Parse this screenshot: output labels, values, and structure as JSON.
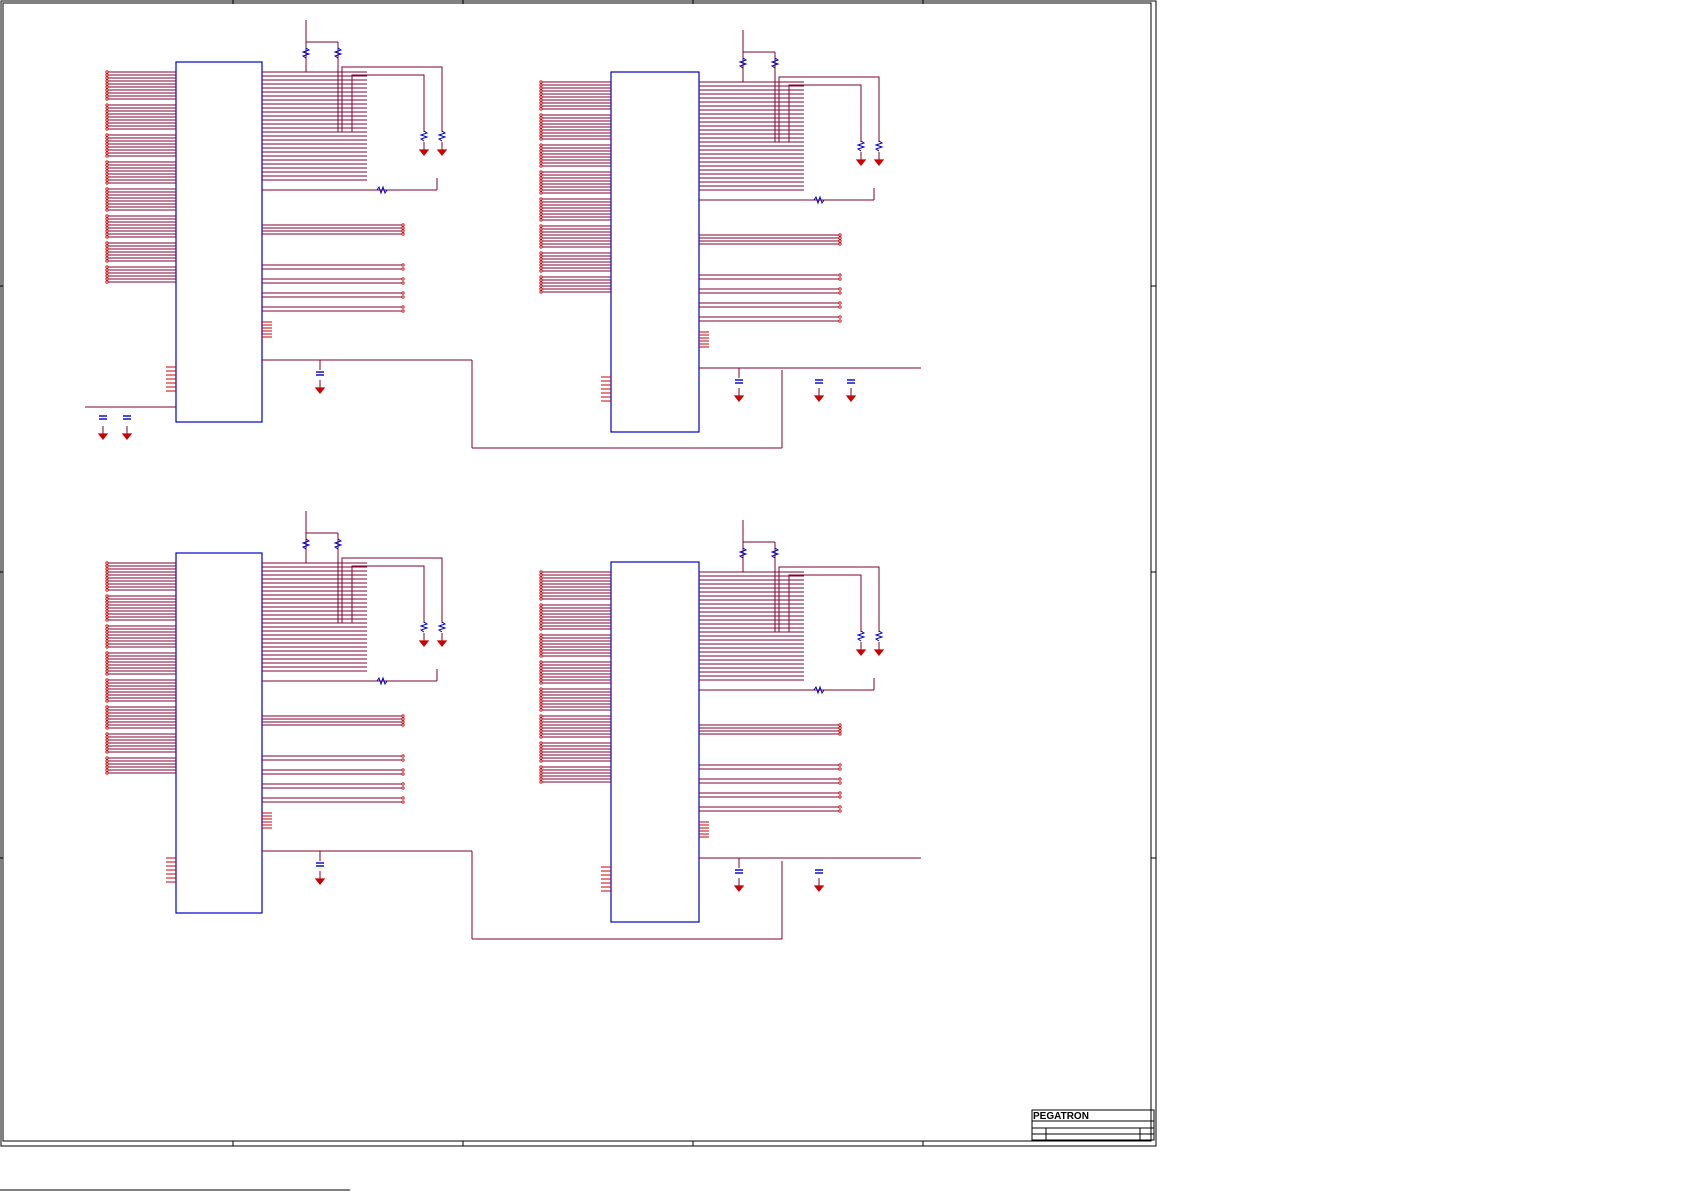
{
  "title_block": {
    "company": "PEGATRON"
  },
  "diagram": {
    "modules": [
      {
        "id": "top-left"
      },
      {
        "id": "top-right"
      },
      {
        "id": "bottom-left"
      },
      {
        "id": "bottom-right"
      }
    ],
    "colors": {
      "chip_outline": "#0000cc",
      "net_wire": "#800030",
      "pin_stub": "#cc0000",
      "frame": "#000000"
    }
  }
}
